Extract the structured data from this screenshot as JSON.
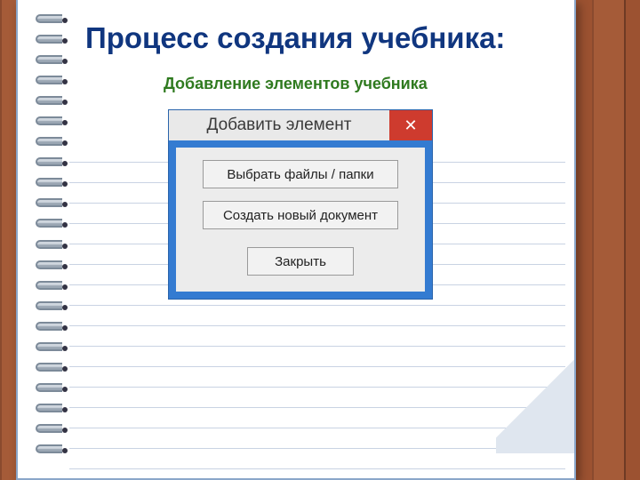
{
  "slide": {
    "title": "Процесс создания учебника:",
    "subtitle": "Добавление элементов учебника"
  },
  "dialog": {
    "title": "Добавить элемент",
    "close_glyph": "✕",
    "buttons": {
      "select_files": "Выбрать файлы / папки",
      "new_document": "Создать новый документ",
      "close": "Закрыть"
    }
  }
}
